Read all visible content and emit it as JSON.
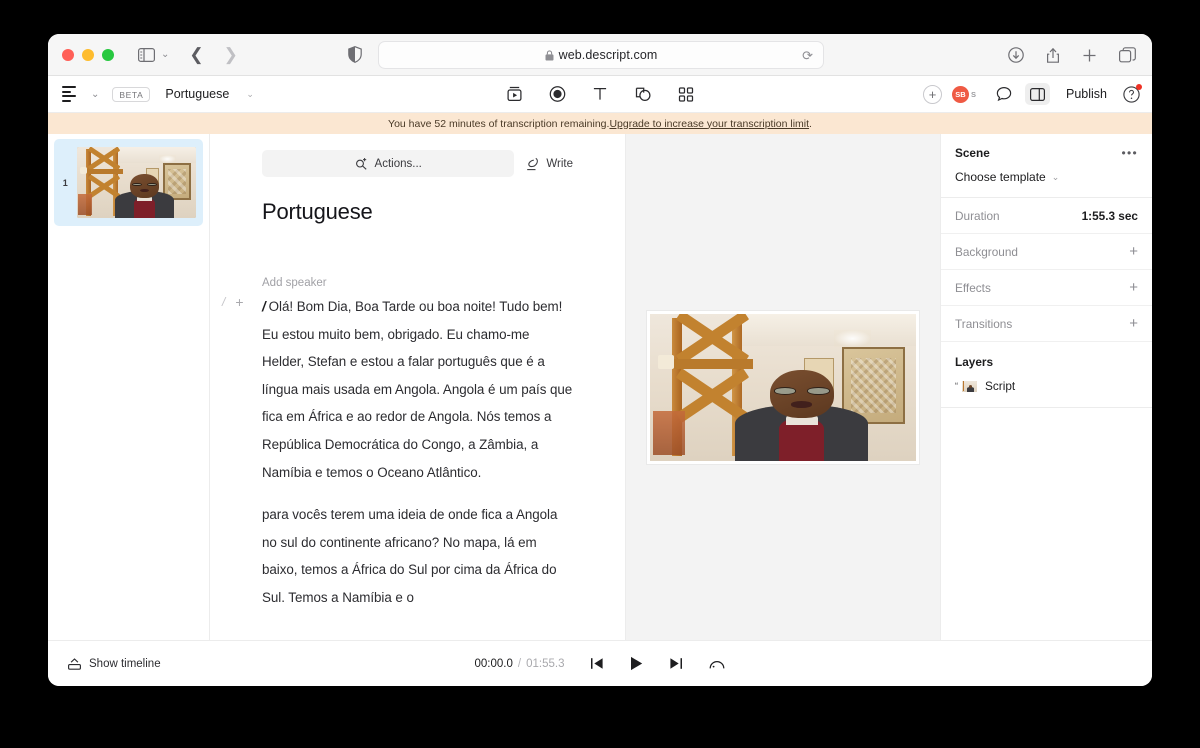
{
  "browser": {
    "url": "web.descript.com",
    "lock_icon": "lock-icon",
    "reload_icon": "reload-icon",
    "shield_icon": "shield-icon",
    "sidebar_icon": "sidebar-toggle-icon",
    "back_icon": "back-arrow-icon",
    "forward_icon": "forward-arrow-icon",
    "download_icon": "download-icon",
    "share_icon": "share-icon",
    "newtab_icon": "plus-icon",
    "tabs_icon": "tabs-overview-icon"
  },
  "app_toolbar": {
    "menu_icon": "hamburger-menu-icon",
    "menu_chevron": "chevron-down-icon",
    "beta_label": "BETA",
    "document_title": "Portuguese",
    "title_chevron": "chevron-down-icon",
    "center_tools": [
      {
        "name": "media-insert-icon",
        "label": "Media"
      },
      {
        "name": "record-icon",
        "label": "Record"
      },
      {
        "name": "text-icon",
        "label": "Text"
      },
      {
        "name": "shapes-icon",
        "label": "Shapes"
      },
      {
        "name": "apps-grid-icon",
        "label": "More"
      }
    ],
    "add_collaborator_icon": "plus-circle-icon",
    "avatars": [
      {
        "initials": "SB",
        "color": "#ef5a44"
      },
      {
        "initials": "S",
        "color": "#b9b9bd"
      }
    ],
    "comment_icon": "comment-bubble-icon",
    "panel_icon": "right-panel-toggle-icon",
    "publish_label": "Publish",
    "help_icon": "help-circle-icon",
    "help_badge_color": "#ef3124"
  },
  "banner": {
    "text_before": "You have 52 minutes of transcription remaining. ",
    "link_text": "Upgrade to increase your transcription limit",
    "text_after": ".",
    "background": "#fbe7d2",
    "minutes_remaining": "52"
  },
  "scenes": [
    {
      "number": "1",
      "selected": true,
      "selected_color": "#ddeffb"
    }
  ],
  "transcript": {
    "actions_label": "Actions...",
    "actions_icon": "magic-wand-icon",
    "write_label": "Write",
    "write_icon": "pen-icon",
    "heading": "Portuguese",
    "add_speaker_label": "Add speaker",
    "gutter_slash": "/",
    "gutter_plus": "+",
    "paragraph_marker": "/",
    "paragraph_1": "Olá! Bom Dia, Boa Tarde ou boa noite! Tudo bem! Eu estou muito bem, obrigado. Eu chamo-me Helder, Stefan e estou a falar português que é a língua mais usada em Angola. Angola é um país que fica em África e ao redor de Angola. Nós temos a República Democrática do Congo, a Zâmbia, a Namíbia e temos o Oceano Atlântico.",
    "paragraph_2": "para vocês terem uma ideia de onde fica a Angola no sul do continente africano? No mapa, lá em baixo, temos a África do Sul por cima da África do Sul. Temos a Namíbia e o"
  },
  "inspector": {
    "title": "Scene",
    "more_icon": "ellipsis-icon",
    "choose_template_label": "Choose template",
    "choose_template_chevron": "chevron-down-icon",
    "rows": [
      {
        "label": "Duration",
        "value": "1:55.3 sec",
        "action": null
      },
      {
        "label": "Background",
        "value": null,
        "action": "+"
      },
      {
        "label": "Effects",
        "value": null,
        "action": "+"
      },
      {
        "label": "Transitions",
        "value": null,
        "action": "+"
      }
    ],
    "layers_title": "Layers",
    "layers": [
      {
        "name": "Script",
        "icon": "script-layer-thumbnail"
      }
    ]
  },
  "transport": {
    "show_timeline_label": "Show timeline",
    "show_timeline_icon": "chevron-up-panel-icon",
    "current_time": "00:00.0",
    "separator": "/",
    "total_time": "01:55.3",
    "skip_back_icon": "skip-back-icon",
    "play_icon": "play-icon",
    "skip_forward_icon": "skip-forward-icon",
    "speed_icon": "playback-speed-icon"
  }
}
